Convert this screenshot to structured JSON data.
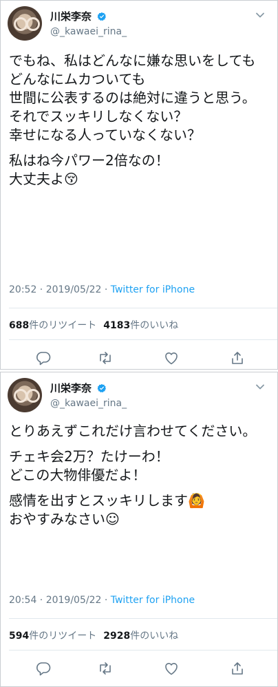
{
  "colors": {
    "link": "#1da1f2",
    "muted": "#657786",
    "text": "#14171a",
    "verified": "#1da1f2"
  },
  "tweets": [
    {
      "user": {
        "name": "川栄李奈",
        "handle": "@_kawaei_rina_",
        "verified_icon": "verified-badge-icon"
      },
      "paragraphs": [
        "でもね、私はどんなに嫌な思いをしても\nどんなにムカついても\n世間に公表するのは絶対に違うと思う。\nそれでスッキリしなくない？\n幸せになる人っていなくない？",
        "私はね今パワー2倍なの！\n大丈夫よ😚"
      ],
      "time": "20:52 · 2019/05/22 · ",
      "source": "Twitter for iPhone",
      "retweets_count": "688",
      "retweets_label": "件のリツイート",
      "likes_count": "4183",
      "likes_label": "件のいいね"
    },
    {
      "user": {
        "name": "川栄李奈",
        "handle": "@_kawaei_rina_",
        "verified_icon": "verified-badge-icon"
      },
      "paragraphs": [
        "とりあえずこれだけ言わせてください。",
        "チェキ会2万？たけーわ！\nどこの大物俳優だよ！",
        "感情を出すとスッキリします🙆\nおやすみなさい☺"
      ],
      "time": "20:54 · 2019/05/22 · ",
      "source": "Twitter for iPhone",
      "retweets_count": "594",
      "retweets_label": "件のリツイート",
      "likes_count": "2928",
      "likes_label": "件のいいね"
    }
  ]
}
